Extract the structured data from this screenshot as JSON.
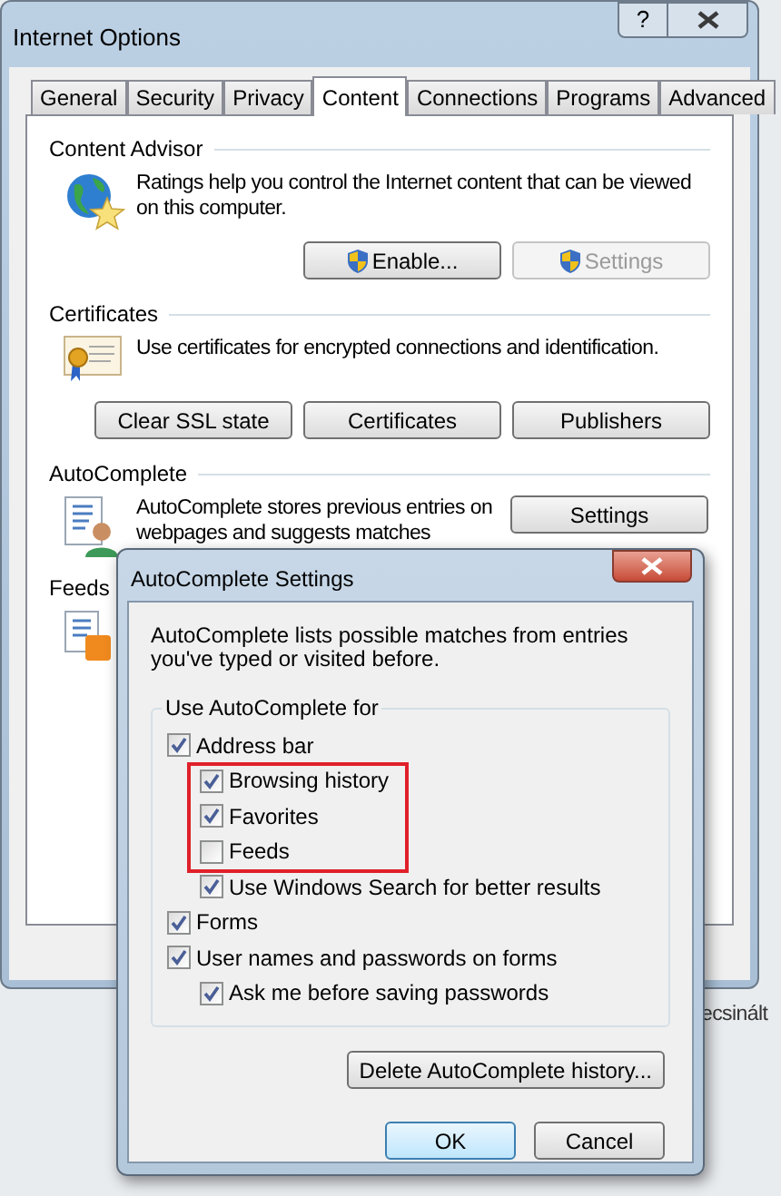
{
  "background": {
    "text": "ecsinált"
  },
  "internet_options": {
    "title": "Internet Options",
    "help_button": "?",
    "tabs": [
      {
        "label": "General",
        "selected": false
      },
      {
        "label": "Security",
        "selected": false
      },
      {
        "label": "Privacy",
        "selected": false
      },
      {
        "label": "Content",
        "selected": true
      },
      {
        "label": "Connections",
        "selected": false
      },
      {
        "label": "Programs",
        "selected": false
      },
      {
        "label": "Advanced",
        "selected": false
      }
    ],
    "sections": [
      {
        "title": "Content Advisor",
        "text": "Ratings help you control the Internet content that can be viewed on this computer.",
        "buttons": [
          {
            "label": "Enable...",
            "shield": true,
            "disabled": false
          },
          {
            "label": "Settings",
            "shield": true,
            "disabled": true
          }
        ]
      },
      {
        "title": "Certificates",
        "text": "Use certificates for encrypted connections and identification.",
        "buttons": [
          {
            "label": "Clear SSL state",
            "shield": false,
            "disabled": false
          },
          {
            "label": "Certificates",
            "shield": false,
            "disabled": false
          },
          {
            "label": "Publishers",
            "shield": false,
            "disabled": false
          }
        ]
      },
      {
        "title": "AutoComplete",
        "text": "AutoComplete stores previous entries on webpages and suggests matches",
        "buttons": [
          {
            "label": "Settings",
            "shield": false,
            "disabled": false
          }
        ]
      },
      {
        "title": "Feeds"
      }
    ]
  },
  "autocomplete_dialog": {
    "title": "AutoComplete Settings",
    "description": "AutoComplete lists possible matches from entries you've typed or visited before.",
    "group_label": "Use AutoComplete for",
    "options": [
      {
        "label": "Address bar",
        "checked": true,
        "children": [
          {
            "label": "Browsing history",
            "checked": true
          },
          {
            "label": "Favorites",
            "checked": true
          },
          {
            "label": "Feeds",
            "checked": false
          },
          {
            "label": "Use Windows Search for better results",
            "checked": true
          }
        ]
      },
      {
        "label": "Forms",
        "checked": true
      },
      {
        "label": "User names and passwords on forms",
        "checked": true,
        "children": [
          {
            "label": "Ask me before saving passwords",
            "checked": true
          }
        ]
      }
    ],
    "highlight_frame": true,
    "delete_button": "Delete AutoComplete history...",
    "buttons": [
      {
        "label": "OK",
        "default": true
      },
      {
        "label": "Cancel",
        "default": false
      }
    ]
  }
}
